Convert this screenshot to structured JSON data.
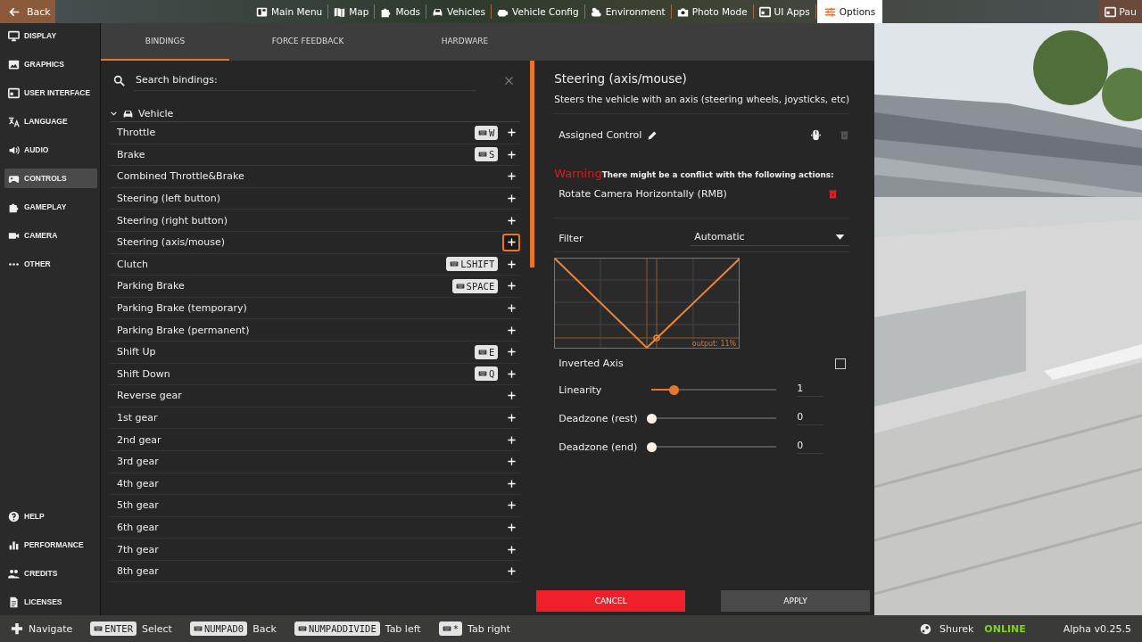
{
  "top_bar": {
    "back": "Back",
    "menu": [
      {
        "label": "Main Menu",
        "selected": false
      },
      {
        "label": "Map",
        "selected": false
      },
      {
        "label": "Mods",
        "selected": false
      },
      {
        "label": "Vehicles",
        "selected": false
      },
      {
        "label": "Vehicle Config",
        "selected": false
      },
      {
        "label": "Environment",
        "selected": false
      },
      {
        "label": "Photo Mode",
        "selected": false
      },
      {
        "label": "UI Apps",
        "selected": false
      },
      {
        "label": "Options",
        "selected": true
      }
    ],
    "user": "Pau"
  },
  "sidebar": {
    "items": [
      {
        "label": "DISPLAY",
        "selected": false
      },
      {
        "label": "GRAPHICS",
        "selected": false
      },
      {
        "label": "USER INTERFACE",
        "selected": false
      },
      {
        "label": "LANGUAGE",
        "selected": false
      },
      {
        "label": "AUDIO",
        "selected": false
      },
      {
        "label": "CONTROLS",
        "selected": true
      },
      {
        "label": "GAMEPLAY",
        "selected": false
      },
      {
        "label": "CAMERA",
        "selected": false
      },
      {
        "label": "OTHER",
        "selected": false
      }
    ],
    "bottom_items": [
      {
        "label": "HELP",
        "selected": false
      },
      {
        "label": "PERFORMANCE",
        "selected": false
      },
      {
        "label": "CREDITS",
        "selected": false
      },
      {
        "label": "LICENSES",
        "selected": false
      }
    ]
  },
  "tabs": [
    {
      "label": "BINDINGS",
      "selected": true
    },
    {
      "label": "FORCE FEEDBACK",
      "selected": false
    },
    {
      "label": "HARDWARE",
      "selected": false
    }
  ],
  "search": {
    "placeholder": "Search bindings:"
  },
  "category": {
    "label": "Vehicle",
    "expanded": true
  },
  "bindings": [
    {
      "label": "Throttle",
      "keys": [
        "W"
      ],
      "selected": false
    },
    {
      "label": "Brake",
      "keys": [
        "S"
      ],
      "selected": false
    },
    {
      "label": "Combined Throttle&Brake",
      "selected": false
    },
    {
      "label": "Steering (left button)",
      "selected": false
    },
    {
      "label": "Steering (right button)",
      "selected": false
    },
    {
      "label": "Steering (axis/mouse)",
      "selected": true
    },
    {
      "label": "Clutch",
      "keys": [
        "LSHIFT"
      ],
      "selected": false
    },
    {
      "label": "Parking Brake",
      "keys": [
        "SPACE"
      ],
      "selected": false
    },
    {
      "label": "Parking Brake (temporary)",
      "selected": false
    },
    {
      "label": "Parking Brake (permanent)",
      "selected": false
    },
    {
      "label": "Shift Up",
      "keys": [
        "E"
      ],
      "selected": false
    },
    {
      "label": "Shift Down",
      "keys": [
        "Q"
      ],
      "selected": false
    },
    {
      "label": "Reverse gear",
      "selected": false
    },
    {
      "label": "1st gear",
      "selected": false
    },
    {
      "label": "2nd gear",
      "selected": false
    },
    {
      "label": "3rd gear",
      "selected": false
    },
    {
      "label": "4th gear",
      "selected": false
    },
    {
      "label": "5th gear",
      "selected": false
    },
    {
      "label": "6th gear",
      "selected": false
    },
    {
      "label": "7th gear",
      "selected": false
    },
    {
      "label": "8th gear",
      "selected": false
    }
  ],
  "detail": {
    "title": "Steering (axis/mouse)",
    "description": "Steers the vehicle with an axis (steering wheels, joysticks, etc)",
    "assigned_control": "Assigned Control",
    "warning": {
      "label": "Warning",
      "message": "There might be a conflict with the following actions:"
    },
    "conflicts": [
      "Rotate Camera Horizontally (RMB)"
    ],
    "filter": {
      "label": "Filter",
      "value": "Automatic"
    },
    "curve": {
      "output": "output: 11%"
    },
    "inverted_axis": {
      "label": "Inverted Axis",
      "checked": false
    },
    "sliders": [
      {
        "label": "Linearity",
        "level": 0.18,
        "reading": "1"
      },
      {
        "label": "Deadzone (rest)",
        "level": 0,
        "reading": "0"
      },
      {
        "label": "Deadzone (end)",
        "level": 0,
        "reading": "0"
      }
    ]
  },
  "buttons": [
    {
      "label": "CANCEL",
      "kind": "danger"
    },
    {
      "label": "APPLY",
      "kind": "normal"
    }
  ],
  "footer": {
    "hints": [
      {
        "label": "Navigate"
      },
      {
        "key": "ENTER",
        "label": "Select"
      },
      {
        "key": "NUMPAD0",
        "label": "Back"
      },
      {
        "key": "NUMPADDIVIDE",
        "label": "Tab left"
      },
      {
        "key": "*",
        "label": "Tab right"
      }
    ],
    "user": "Shurek",
    "status": "ONLINE",
    "version": "Alpha v0.25.5"
  }
}
